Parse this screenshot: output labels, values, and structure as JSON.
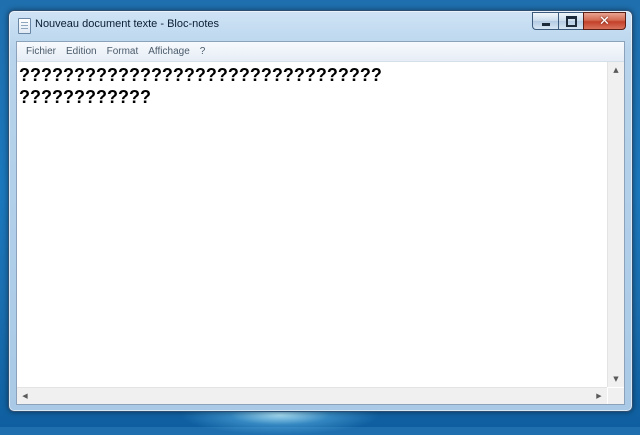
{
  "window": {
    "title": "Nouveau document texte - Bloc-notes",
    "icon": "notepad-icon",
    "caption_buttons": {
      "minimize": "minimize-icon",
      "maximize": "maximize-icon",
      "close_glyph": "✕"
    }
  },
  "menubar": {
    "items": [
      "Fichier",
      "Edition",
      "Format",
      "Affichage",
      "?"
    ]
  },
  "editor": {
    "lines": [
      "?????????????????????????????????",
      "????????????"
    ]
  },
  "scrollbars": {
    "up": "▲",
    "down": "▼",
    "left": "◀",
    "right": "▶"
  },
  "colors": {
    "desktop": "#1b78bd",
    "close_button": "#c4402a",
    "text": "#000000"
  }
}
